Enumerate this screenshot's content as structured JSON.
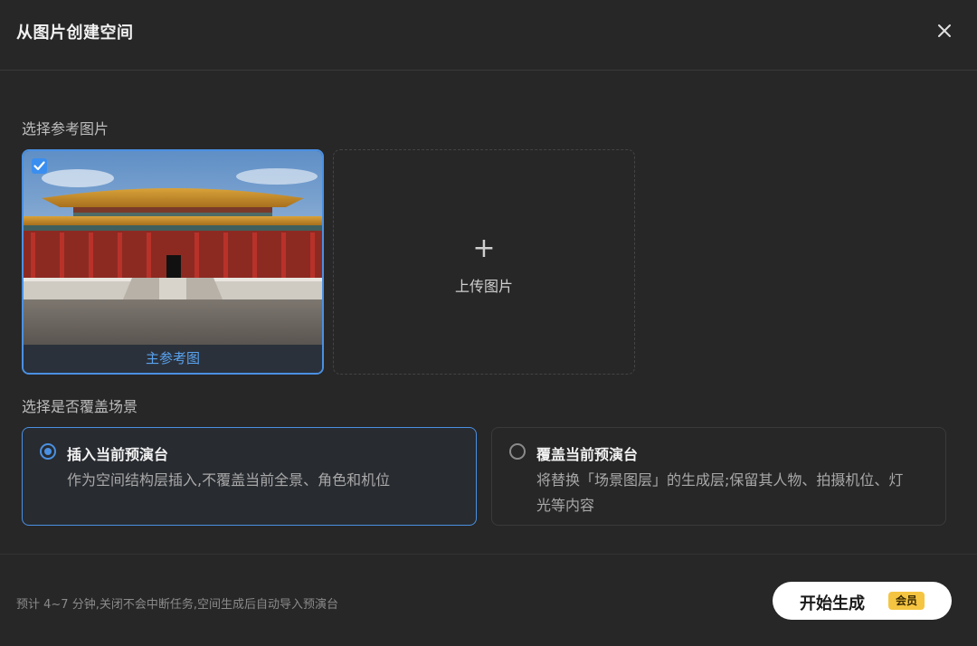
{
  "dialog": {
    "title": "从图片创建空间",
    "close_icon": "close-icon"
  },
  "reference": {
    "section_label": "选择参考图片",
    "main_caption": "主参考图",
    "upload_label": "上传图片",
    "upload_icon": "plus-icon",
    "image_subject": "imperial palace hall"
  },
  "overlay": {
    "section_label": "选择是否覆盖场景",
    "options": [
      {
        "title": "插入当前预演台",
        "description": "作为空间结构层插入,不覆盖当前全景、角色和机位",
        "selected": true
      },
      {
        "title": "覆盖当前预演台",
        "description": "将替换「场景图层」的生成层;保留其人物、拍摄机位、灯光等内容",
        "selected": false
      }
    ]
  },
  "footer": {
    "note": "预计 4~7 分钟,关闭不会中断任务,空间生成后自动导入预演台",
    "start_label": "开始生成",
    "vip_badge": "会员"
  },
  "colors": {
    "accent": "#4a90e2",
    "background": "#272727",
    "badge": "#f5c542"
  }
}
